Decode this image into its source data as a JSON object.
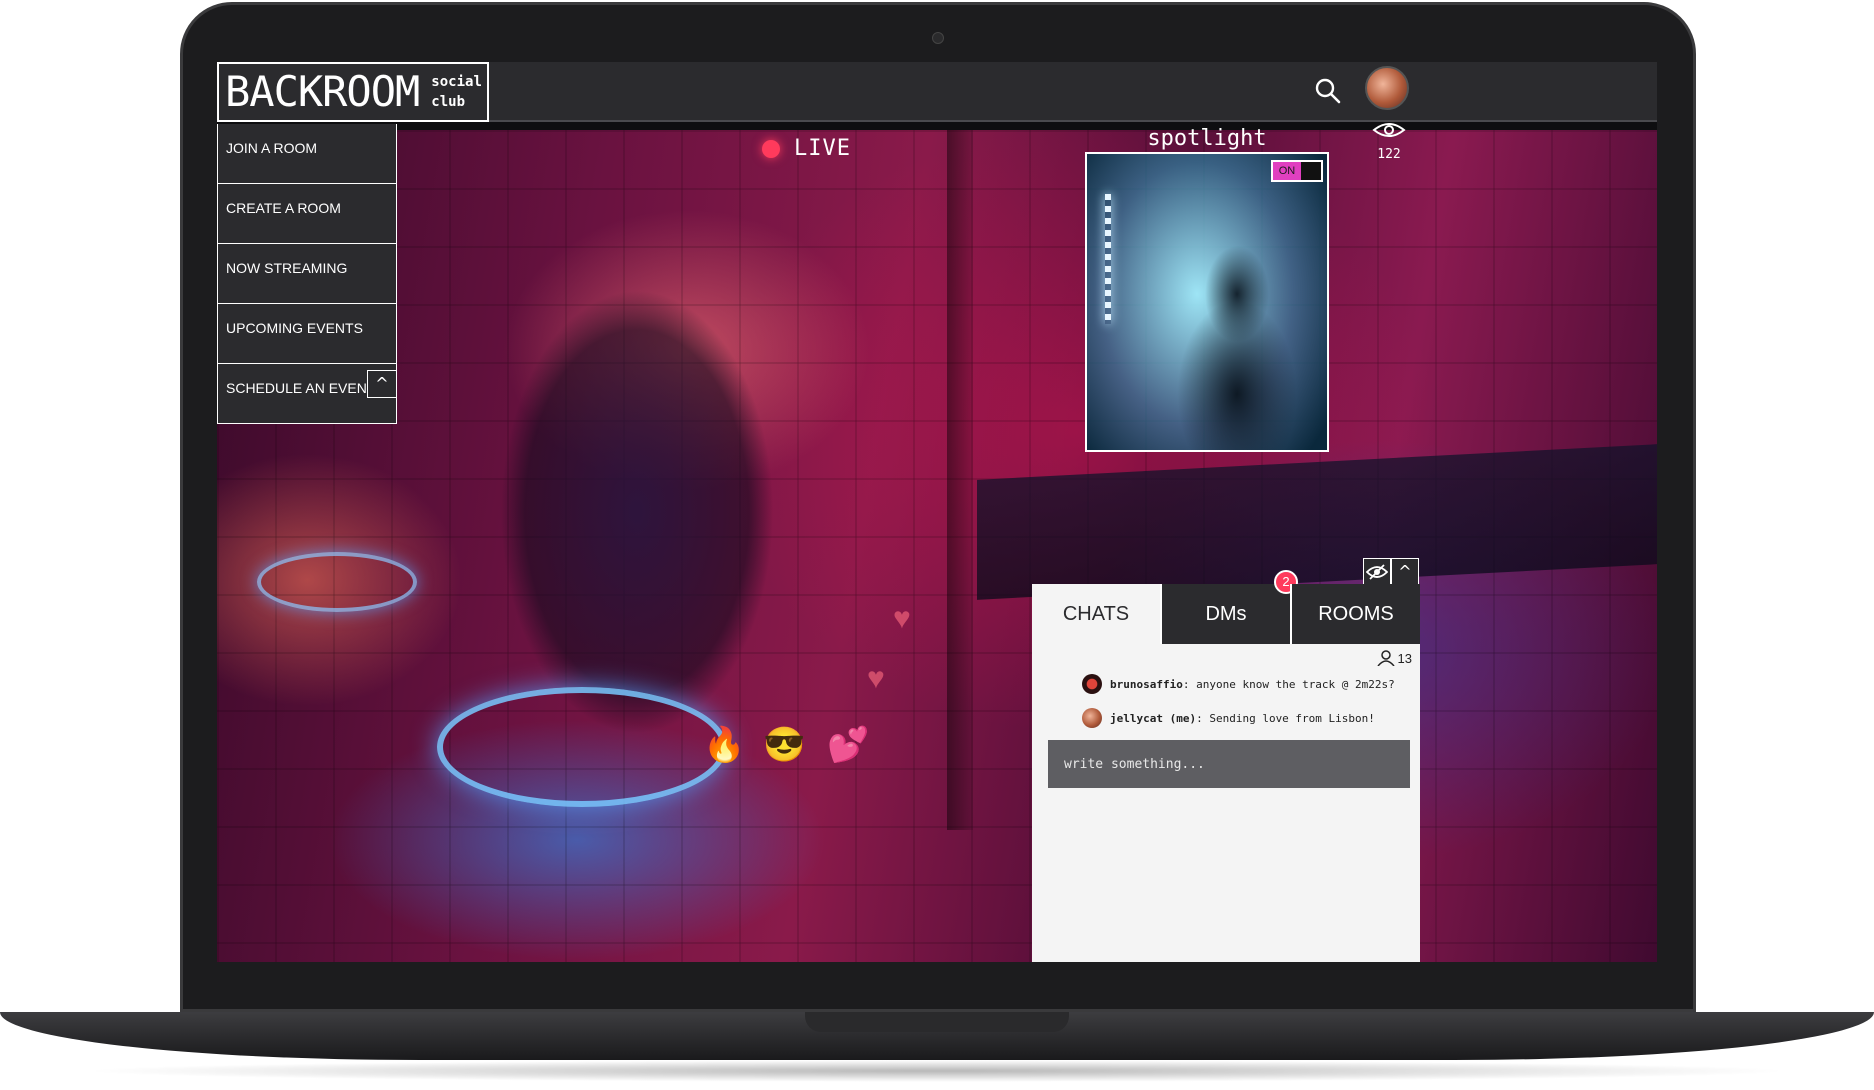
{
  "brand": {
    "name": "BACKROOM",
    "sub": "social club"
  },
  "header": {
    "search_icon": "search-icon",
    "avatar_icon": "user-avatar"
  },
  "menu": {
    "items": [
      {
        "label": "JOIN A ROOM"
      },
      {
        "label": "CREATE A ROOM"
      },
      {
        "label": "NOW STREAMING"
      },
      {
        "label": "UPCOMING EVENTS"
      },
      {
        "label": "SCHEDULE AN EVENT"
      }
    ],
    "collapse_glyph": "^"
  },
  "live": {
    "label": "LIVE",
    "color": "#ff3a5c"
  },
  "spotlight": {
    "label": "spotlight",
    "toggle_label": "ON",
    "toggle_color": "#e040c0"
  },
  "viewers": {
    "count": "122",
    "icon": "eye-icon"
  },
  "reactions": {
    "fire": "🔥",
    "cool": "😎",
    "hearts": "💕"
  },
  "chat": {
    "hide_glyph": "◉",
    "collapse_glyph": "^",
    "tabs": [
      {
        "label": "CHATS",
        "active": true
      },
      {
        "label": "DMs",
        "badge": "2"
      },
      {
        "label": "ROOMS"
      }
    ],
    "member_count": "13",
    "messages": [
      {
        "user": "brunosaffio",
        "text": ": anyone know the track @ 2m22s?"
      },
      {
        "user": "jellycat (me)",
        "text": ": Sending love from Lisbon!"
      }
    ],
    "compose_placeholder": "write something..."
  },
  "colors": {
    "accent": "#ff3a5c",
    "panel": "#2b2b2e",
    "toggle": "#e040c0"
  }
}
